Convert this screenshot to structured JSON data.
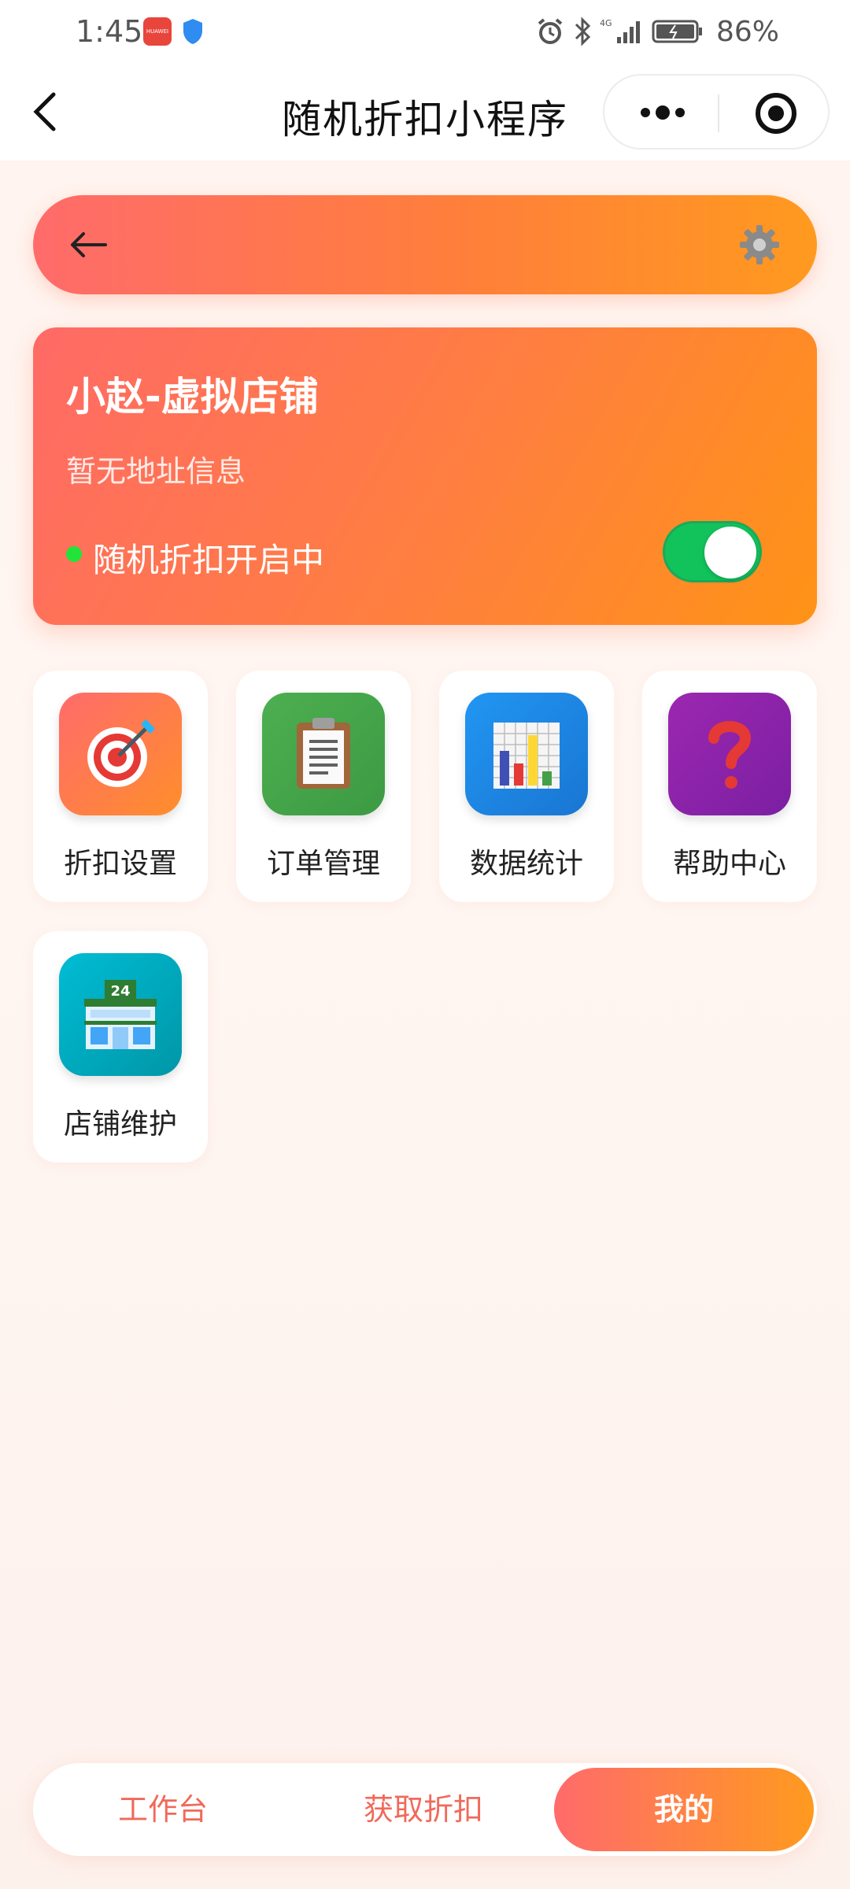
{
  "status_bar": {
    "time": "1:45",
    "app_badge": "HUAWEI",
    "battery_percent": "86%"
  },
  "nav": {
    "title": "随机折扣小程序"
  },
  "shop": {
    "name": "小赵-虚拟店铺",
    "address": "暂无地址信息",
    "status_text": "随机折扣开启中",
    "toggle_on": true
  },
  "grid": [
    {
      "label": "折扣设置",
      "icon": "target-icon",
      "color": "#ff7a45"
    },
    {
      "label": "订单管理",
      "icon": "clipboard-icon",
      "color": "#4caf50"
    },
    {
      "label": "数据统计",
      "icon": "bar-chart-icon",
      "color": "#2196f3"
    },
    {
      "label": "帮助中心",
      "icon": "question-icon",
      "color": "#9c27b0"
    },
    {
      "label": "店铺维护",
      "icon": "store-icon",
      "color": "#00bcd4"
    }
  ],
  "tabs": [
    {
      "label": "工作台",
      "active": false
    },
    {
      "label": "获取折扣",
      "active": false
    },
    {
      "label": "我的",
      "active": true
    }
  ],
  "colors": {
    "accent_start": "#ff6b6b",
    "accent_end": "#ff9a1f",
    "toggle_on": "#12c35c"
  }
}
